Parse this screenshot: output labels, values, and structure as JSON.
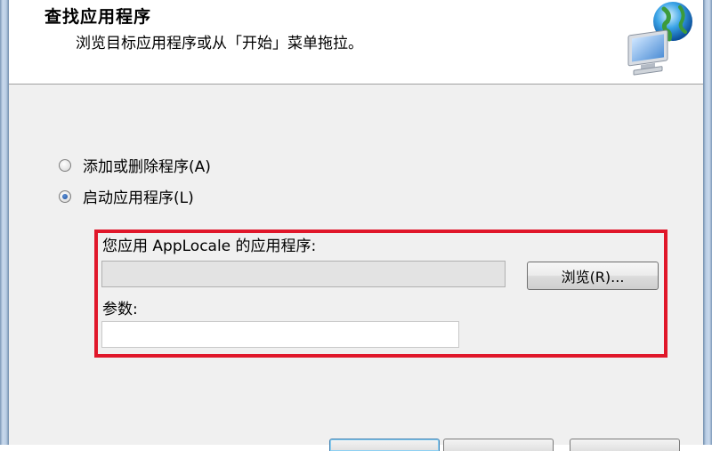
{
  "header": {
    "title": "查找应用程序",
    "subtitle": "浏览目标应用程序或从「开始」菜单拖拉。",
    "logo_icon": "globe-computer-icon"
  },
  "options": {
    "add_remove_label": "添加或删除程序(A)",
    "start_app_label": "启动应用程序(L)",
    "selected": "start_app"
  },
  "app_section": {
    "app_label": "您应用 AppLocale 的应用程序:",
    "app_value": "",
    "browse_label": "浏览(R)...",
    "params_label": "参数:",
    "params_value": ""
  },
  "colors": {
    "highlight": "#e0172a",
    "dialog_bg": "#f0f0f0"
  }
}
